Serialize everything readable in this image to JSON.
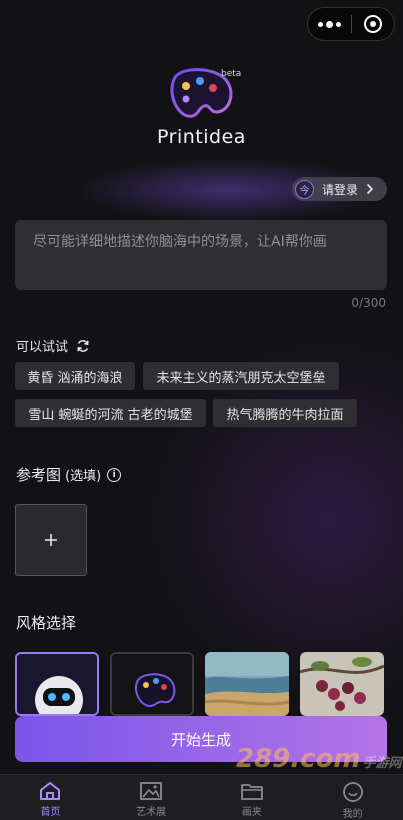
{
  "header": {
    "beta": "beta",
    "app_title": "Printidea"
  },
  "login": {
    "label": "请登录",
    "icon_char": "今"
  },
  "prompt": {
    "placeholder": "尽可能详细地描述你脑海中的场景，让AI帮你画",
    "counter": "0/300"
  },
  "suggestions": {
    "title": "可以试试",
    "chips": [
      "黄昏 汹涌的海浪",
      "未来主义的蒸汽朋克太空堡垒",
      "雪山 蜿蜒的河流 古老的城堡",
      "热气腾腾的牛肉拉面"
    ]
  },
  "reference": {
    "title": "参考图",
    "optional": "(选填)",
    "info_glyph": "i"
  },
  "styles": {
    "title": "风格选择",
    "cards": [
      "robot-avatar",
      "palette-logo",
      "ocean-shore",
      "cherry-branch"
    ]
  },
  "generate": {
    "label": "开始生成"
  },
  "watermark": {
    "num": "289",
    "suffix": ".com",
    "site": "手游网"
  },
  "tabbar": {
    "tabs": [
      {
        "label": "首页",
        "icon": "home-icon",
        "active": true
      },
      {
        "label": "艺术展",
        "icon": "gallery-icon",
        "active": false
      },
      {
        "label": "画夹",
        "icon": "folder-icon",
        "active": false
      },
      {
        "label": "我的",
        "icon": "profile-icon",
        "active": false
      }
    ]
  },
  "colors": {
    "accent": "#9b7cf0",
    "background": "#121214",
    "button_gradient_start": "#7b55ea",
    "button_gradient_end": "#b374e6"
  }
}
